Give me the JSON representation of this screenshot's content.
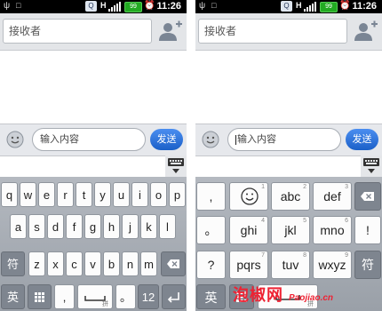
{
  "status_bar": {
    "time": "11:26",
    "network": "H",
    "pingpai": "Q",
    "battery": "99"
  },
  "recipient": {
    "placeholder": "接收者"
  },
  "compose": {
    "placeholder": "输入内容",
    "send_label": "发送"
  },
  "qwerty": {
    "row1": [
      "q",
      "w",
      "e",
      "r",
      "t",
      "y",
      "u",
      "i",
      "o",
      "p"
    ],
    "row2": [
      "a",
      "s",
      "d",
      "f",
      "g",
      "h",
      "j",
      "k",
      "l"
    ],
    "row3": [
      "z",
      "x",
      "c",
      "v",
      "b",
      "n",
      "m"
    ],
    "shift_label": "符",
    "lang_label": "英",
    "comma_label": ",",
    "space_sub": "拼",
    "period_label": "。",
    "num_label": "12"
  },
  "t9": {
    "col1": [
      ",",
      "。",
      "?",
      "!"
    ],
    "keys": [
      {
        "num": "1",
        "label": ""
      },
      {
        "num": "2",
        "label": "abc"
      },
      {
        "num": "3",
        "label": "def"
      },
      {
        "num": "4",
        "label": "ghi"
      },
      {
        "num": "5",
        "label": "jkl"
      },
      {
        "num": "6",
        "label": "mno"
      },
      {
        "num": "7",
        "label": "pqrs"
      },
      {
        "num": "8",
        "label": "tuv"
      },
      {
        "num": "9",
        "label": "wxyz"
      }
    ],
    "exclaim": "!",
    "sym_label": "符",
    "lang_label": "英",
    "space_sub": "拼"
  },
  "watermark": {
    "main": "泡椒网",
    "site": "Paojiao.cn"
  },
  "colors": {
    "send": "#2f78dc",
    "keyboard_bg": "#a7acb3",
    "dark_key": "#7e858f"
  }
}
